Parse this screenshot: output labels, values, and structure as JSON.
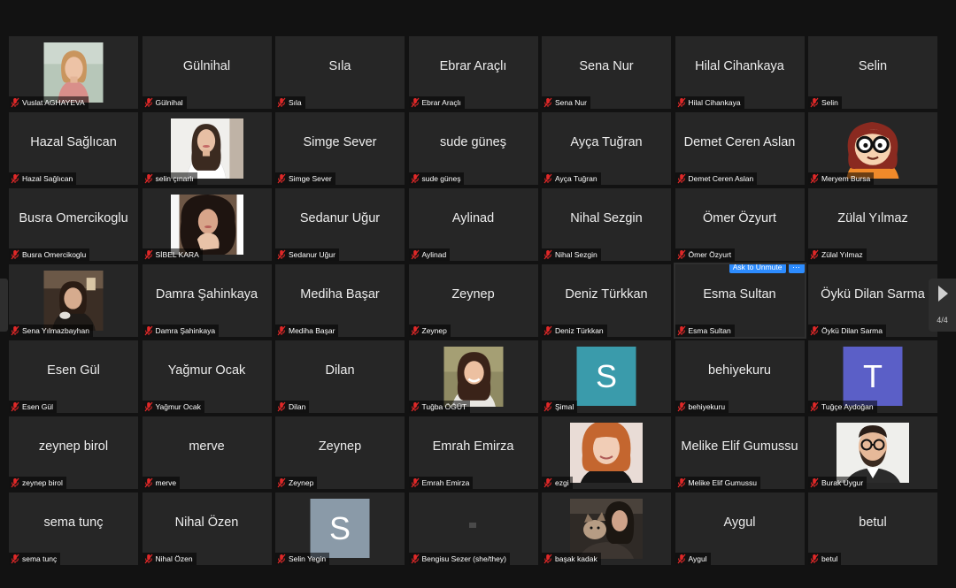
{
  "page_indicator": "4/4",
  "colors": {
    "tile": "#262626",
    "background": "#121212",
    "mute_icon": "#e02828",
    "accent": "#2d8cff"
  },
  "unmute_popup": {
    "ask_label": "Ask to Unmute",
    "more_label": "···"
  },
  "participants": [
    {
      "name": "Vuslat  AGHAYEVA",
      "display": "photo",
      "photo": "woman-light-hair-indoor"
    },
    {
      "name": "Gülnihal",
      "display": "text",
      "text": "Gülnihal"
    },
    {
      "name": "Sıla",
      "display": "text",
      "text": "Sıla"
    },
    {
      "name": "Ebrar Araçlı",
      "display": "text",
      "text": "Ebrar Araçlı"
    },
    {
      "name": "Sena Nur",
      "display": "text",
      "text": "Sena Nur"
    },
    {
      "name": "Hilal Cihankaya",
      "display": "text",
      "text": "Hilal Cihankaya"
    },
    {
      "name": "Selin",
      "display": "text",
      "text": "Selin"
    },
    {
      "name": "Hazal Sağlıcan",
      "display": "text",
      "text": "Hazal Sağlıcan"
    },
    {
      "name": "selin çınarlı",
      "display": "photo",
      "photo": "woman-dark-hair-white-top"
    },
    {
      "name": "Simge Sever",
      "display": "text",
      "text": "Simge Sever"
    },
    {
      "name": "sude güneş",
      "display": "text",
      "text": "sude güneş"
    },
    {
      "name": "Ayça Tuğran",
      "display": "text",
      "text": "Ayça Tuğran"
    },
    {
      "name": "Demet Ceren Aslan",
      "display": "text",
      "text": "Demet Ceren Aslan"
    },
    {
      "name": "Meryem Bursa",
      "display": "photo",
      "photo": "cartoon-character-glasses"
    },
    {
      "name": "Busra Omercikoglu",
      "display": "text",
      "text": "Busra Omercikoglu"
    },
    {
      "name": "SİBEL KARA",
      "display": "photo",
      "photo": "woman-curly-hair-selfie"
    },
    {
      "name": "Sedanur Uğur",
      "display": "text",
      "text": "Sedanur Uğur"
    },
    {
      "name": "Aylinad",
      "display": "text",
      "text": "Aylinad"
    },
    {
      "name": "Nihal Sezgin",
      "display": "text",
      "text": "Nihal Sezgin"
    },
    {
      "name": "Ömer Özyurt",
      "display": "text",
      "text": "Ömer Özyurt"
    },
    {
      "name": "Zülal Yılmaz",
      "display": "text",
      "text": "Zülal Yılmaz"
    },
    {
      "name": "Sena Yılmazbayhan",
      "display": "photo",
      "photo": "woman-cafe"
    },
    {
      "name": "Damra Şahinkaya",
      "display": "text",
      "text": "Damra Şahinkaya"
    },
    {
      "name": "Mediha Başar",
      "display": "text",
      "text": "Mediha Başar"
    },
    {
      "name": "Zeynep",
      "display": "text",
      "text": "Zeynep"
    },
    {
      "name": "Deniz Türkkan",
      "display": "text",
      "text": "Deniz Türkkan"
    },
    {
      "name": "Esma Sultan",
      "display": "text",
      "text": "Esma Sultan",
      "active": true
    },
    {
      "name": "Öykü Dilan Sarma",
      "display": "text",
      "text": "Öykü Dilan Sarma"
    },
    {
      "name": "Esen Gül",
      "display": "text",
      "text": "Esen Gül"
    },
    {
      "name": "Yağmur Ocak",
      "display": "text",
      "text": "Yağmur Ocak"
    },
    {
      "name": "Dilan",
      "display": "text",
      "text": "Dilan"
    },
    {
      "name": "Tuğba ÖĞÜT",
      "display": "photo",
      "photo": "woman-smiling-outdoor"
    },
    {
      "name": "Şimal",
      "display": "avatar",
      "letter": "S",
      "color": "#3a9bab"
    },
    {
      "name": "behiyekuru",
      "display": "text",
      "text": "behiyekuru"
    },
    {
      "name": "Tuğçe Aydoğan",
      "display": "avatar",
      "letter": "T",
      "color": "#5b5fc7"
    },
    {
      "name": "zeynep birol",
      "display": "text",
      "text": "zeynep birol"
    },
    {
      "name": "merve",
      "display": "text",
      "text": "merve"
    },
    {
      "name": "Zeynep",
      "display": "text",
      "text": "Zeynep"
    },
    {
      "name": "Emrah Emirza",
      "display": "text",
      "text": "Emrah Emirza"
    },
    {
      "name": "ezgi",
      "display": "photo",
      "photo": "woman-red-hair"
    },
    {
      "name": "Melike Elif Gumussu",
      "display": "text",
      "text": "Melike Elif Gumussu"
    },
    {
      "name": "Burak Uygur",
      "display": "photo",
      "photo": "man-glasses-beard"
    },
    {
      "name": "sema tunç",
      "display": "text",
      "text": "sema tunç"
    },
    {
      "name": "Nihal Özen",
      "display": "text",
      "text": "Nihal Özen"
    },
    {
      "name": "Selin Yegin",
      "display": "avatar",
      "letter": "S",
      "color": "#8a9aa8"
    },
    {
      "name": "Bengisu Sezer (she/they)",
      "display": "dim",
      "text": ""
    },
    {
      "name": "başak kadak",
      "display": "photo",
      "photo": "woman-with-dog"
    },
    {
      "name": "Aygul",
      "display": "text",
      "text": "Aygul"
    },
    {
      "name": "betul",
      "display": "text",
      "text": "betul"
    }
  ]
}
